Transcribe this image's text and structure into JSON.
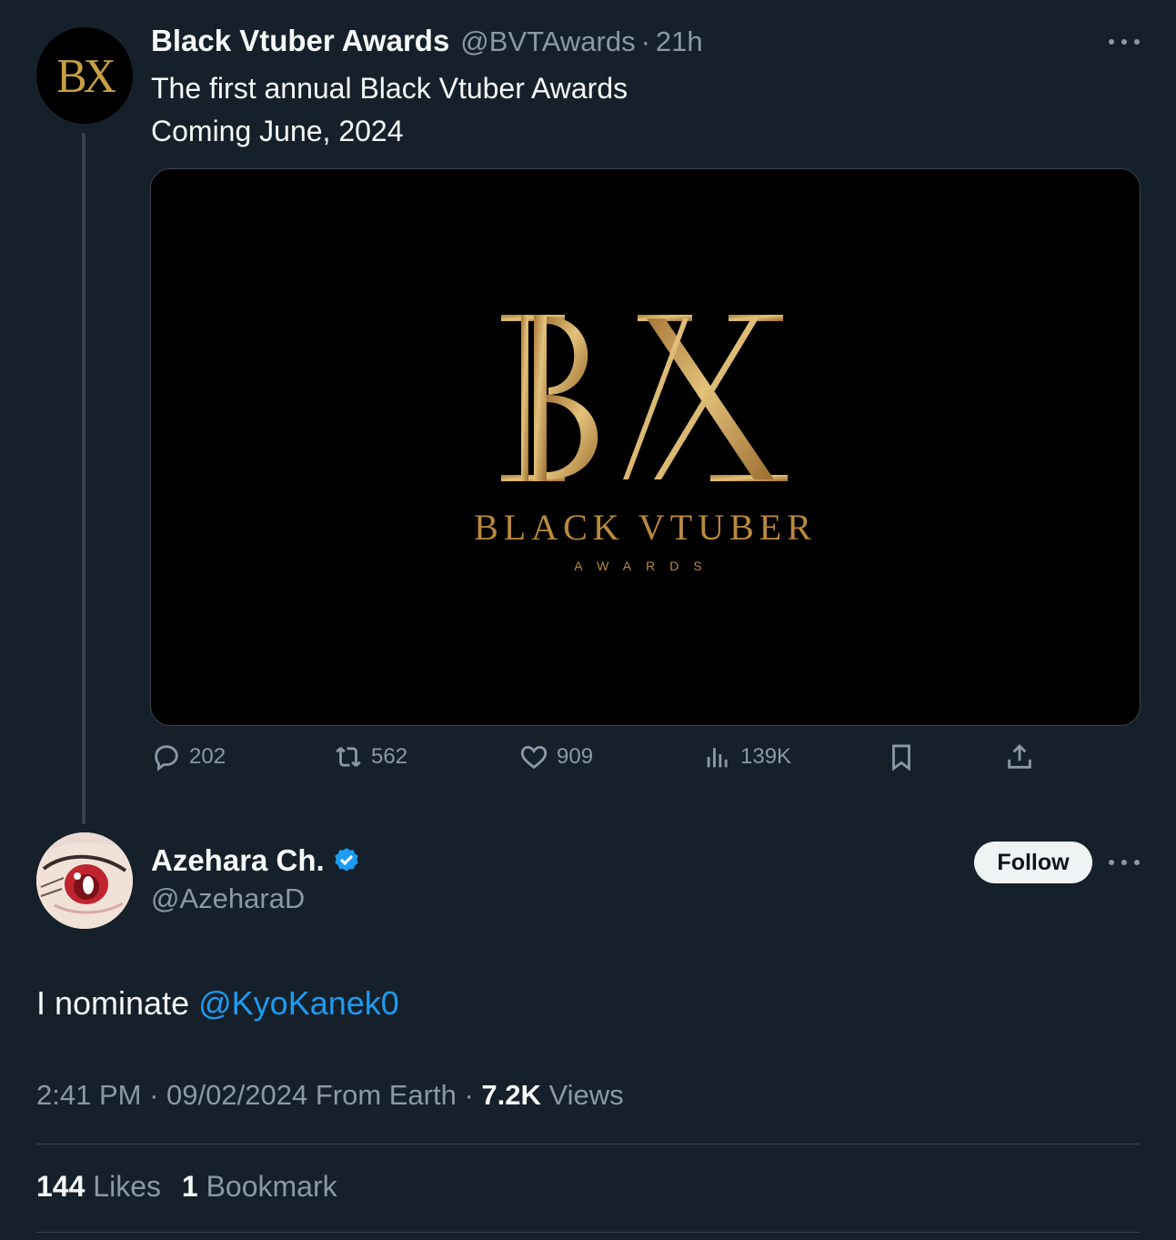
{
  "parent_tweet": {
    "avatar_text": "BX",
    "display_name": "Black Vtuber Awards",
    "handle": "@BVTAwards",
    "separator": "·",
    "time": "21h",
    "text_line1": "The first annual Black Vtuber Awards",
    "text_line2": "Coming June, 2024",
    "media": {
      "logo_letters": "BX",
      "logo_title": "BLACK VTUBER",
      "logo_subtitle": "AWARDS",
      "gold_color": "#c39a4b"
    },
    "actions": {
      "replies": "202",
      "reposts": "562",
      "likes": "909",
      "views": "139K"
    }
  },
  "reply_tweet": {
    "display_name": "Azehara Ch.",
    "handle": "@AzeharaD",
    "follow_label": "Follow",
    "text_prefix": "I nominate ",
    "mention": "@KyoKanek0",
    "time": "2:41 PM",
    "date": "09/02/2024",
    "source": "From Earth",
    "separator": "·",
    "views_count": "7.2K",
    "views_label": "Views",
    "likes_count": "144",
    "likes_label": "Likes",
    "bookmarks_count": "1",
    "bookmarks_label": "Bookmark"
  },
  "colors": {
    "background": "#15202b",
    "accent": "#1d9bf0",
    "muted": "#8b98a5"
  }
}
